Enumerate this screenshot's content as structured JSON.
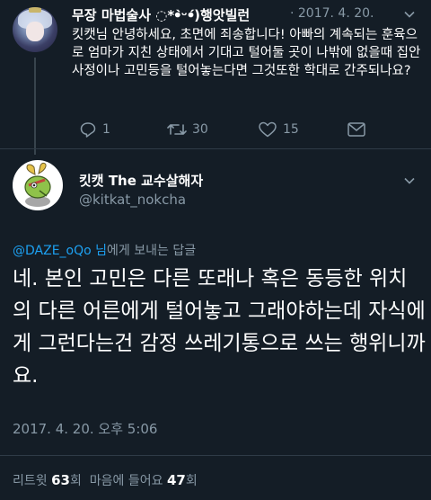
{
  "tweet1": {
    "name": "무장 마법술사 ◌*ꔷ̀ᵕꔷ́)행앗빌런",
    "date": "· 2017. 4. 20.",
    "text": "킷캣님 안녕하세요, 초면에 죄송합니다! 아빠의 계속되는 훈육으로 엄마가 지친 상태에서 기대고 털어둘 곳이 나밖에 없을때 집안사정이나 고민등을 털어놓는다면 그것또한 학대로 간주되나요?",
    "replies": "1",
    "retweets": "30",
    "likes": "15"
  },
  "tweet2": {
    "name": "킷캣 The 교수살해자",
    "handle": "@kitkat_nokcha",
    "reply_mention": "@DAZE_oQo 님",
    "reply_suffix": "에게 보내는 답글",
    "text": "네. 본인 고민은 다른 또래나 혹은 동등한 위치의 다른 어른에게 털어놓고 그래야하는데 자식에게 그런다는건 감정 쓰레기통으로 쓰는 행위니까요.",
    "timestamp": "2017. 4. 20. 오후 5:06",
    "retweets_label": "리트윗",
    "retweets_count": "63",
    "retweets_unit": "회",
    "likes_label": "마음에 들어요",
    "likes_count": "47",
    "likes_unit": "회"
  },
  "colors": {
    "background": "#141d26",
    "secondary_text": "#8899a6",
    "link": "#1da1f2",
    "divider": "#2f3b47"
  },
  "icons": [
    "reply-icon",
    "retweet-icon",
    "heart-icon",
    "dm-envelope-icon",
    "chevron-down-icon"
  ]
}
